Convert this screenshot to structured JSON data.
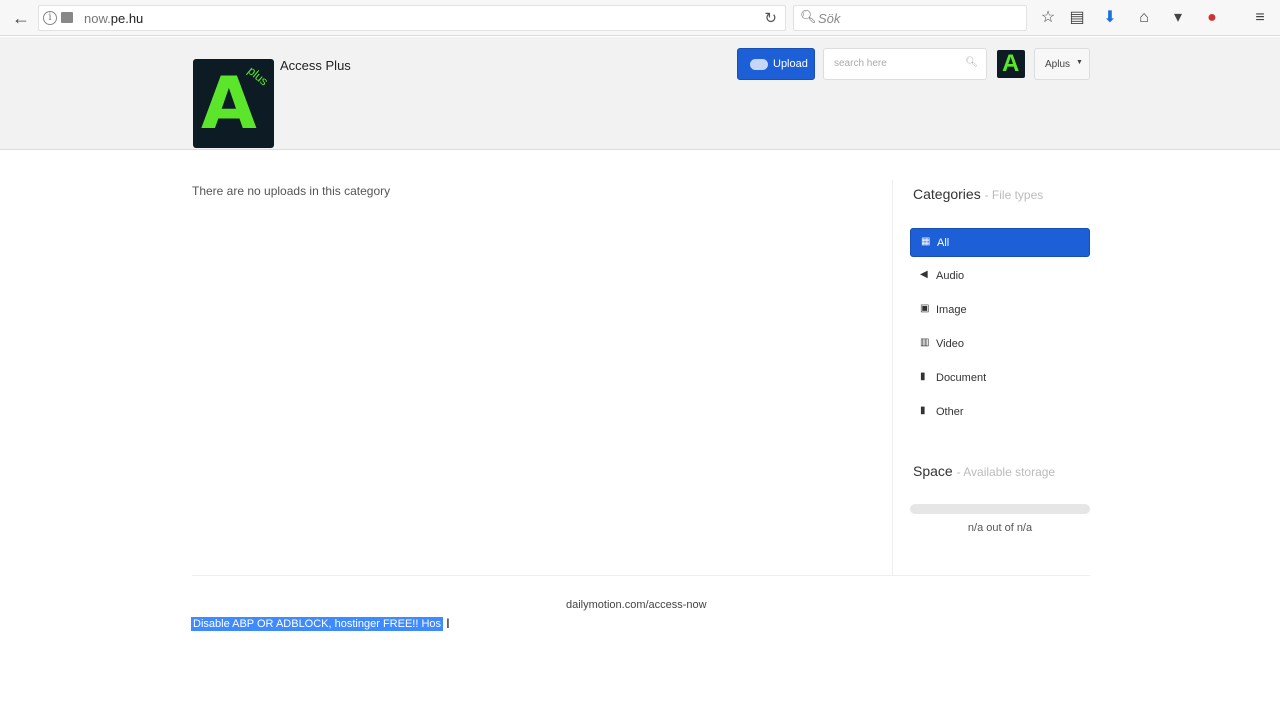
{
  "browser": {
    "url_prefix": "now.",
    "url_domain": "pe.hu",
    "search_placeholder": "Sök"
  },
  "header": {
    "site_title": "Access Plus",
    "logo_letter": "A",
    "logo_small": "plus",
    "upload_label": "Upload",
    "search_placeholder": "search here",
    "avatar_letter": "A",
    "user_menu_label": "Aplus"
  },
  "main": {
    "empty_message": "There are no uploads in this category"
  },
  "sidebar": {
    "categories_title": "Categories",
    "categories_subtitle": "- File types",
    "items": [
      {
        "label": "All",
        "icon": "grid-icon"
      },
      {
        "label": "Audio",
        "icon": "speaker-icon"
      },
      {
        "label": "Image",
        "icon": "camera-icon"
      },
      {
        "label": "Video",
        "icon": "film-icon"
      },
      {
        "label": "Document",
        "icon": "book-icon"
      },
      {
        "label": "Other",
        "icon": "file-icon"
      }
    ],
    "space_title": "Space",
    "space_subtitle": "- Available storage",
    "storage_text": "n/a out of n/a",
    "storage_fraction": 0
  },
  "footer": {
    "link": "dailymotion.com/access-now",
    "ad_text": "Disable ABP OR ADBLOCK, hostinger FREE!! Hos"
  },
  "colors": {
    "accent": "#1d5fd6",
    "logo_bg": "#0d1b24",
    "logo_fg": "#5be62c",
    "selection": "#3d8bff"
  }
}
